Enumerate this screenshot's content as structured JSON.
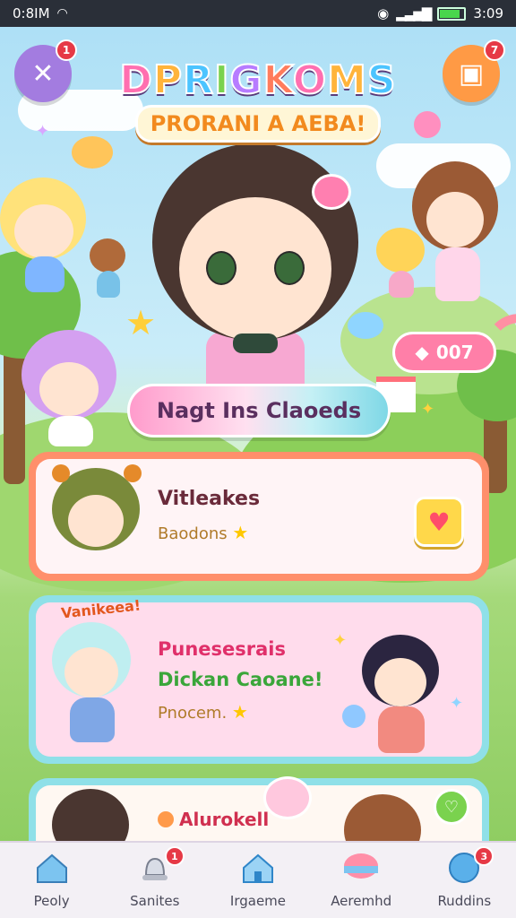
{
  "status_bar": {
    "time_left": "0:8IM",
    "time_right": "3:09"
  },
  "header": {
    "title": "DPRIGKOMS",
    "subtitle": "PRORANI A AEBA!",
    "back_badge": "1",
    "shop_badge": "7"
  },
  "counter": {
    "value": "007"
  },
  "banner": {
    "text": "Nagt Ins Claoeds"
  },
  "cards": [
    {
      "title": "Vitleakes",
      "subtitle": "Baodons"
    },
    {
      "tag": "Vanikeea!",
      "line1": "Punesesrais",
      "line2": "Dickan Caoane!",
      "subtitle": "Pnocem."
    },
    {
      "title": "Alurokell"
    }
  ],
  "nav": [
    {
      "label": "Peoly",
      "icon": "home-icon",
      "badge": ""
    },
    {
      "label": "Sanites",
      "icon": "bell-icon",
      "badge": "1"
    },
    {
      "label": "Irgaeme",
      "icon": "house-icon",
      "badge": ""
    },
    {
      "label": "Aeremhd",
      "icon": "bowl-icon",
      "badge": ""
    },
    {
      "label": "Ruddins",
      "icon": "chat-icon",
      "badge": "3"
    }
  ],
  "colors": {
    "accent_pink": "#ff7fa8",
    "nav_bg": "#f3f0f5",
    "badge_red": "#e63946"
  }
}
